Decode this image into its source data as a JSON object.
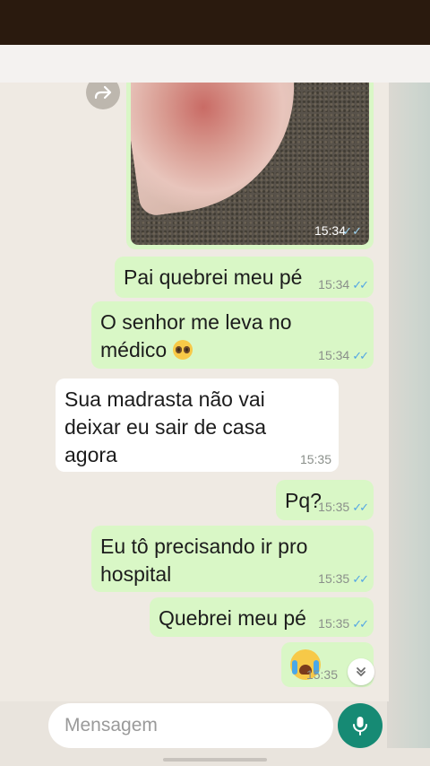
{
  "chat": {
    "image_message": {
      "time": "15:34",
      "status": "read"
    },
    "messages": [
      {
        "id": "m1",
        "direction": "out",
        "text": "Pai quebrei meu pé",
        "time": "15:34",
        "status": "read"
      },
      {
        "id": "m2",
        "direction": "out",
        "line1": "O senhor me leva no",
        "line2": "médico",
        "emoji": "pleading-face-emoji",
        "time": "15:34",
        "status": "read"
      },
      {
        "id": "m3",
        "direction": "in",
        "line1": "Sua madrasta não vai",
        "line2": "deixar eu sair de casa",
        "line3": "agora",
        "time": "15:35"
      },
      {
        "id": "m4",
        "direction": "out",
        "text": "Pq?",
        "time": "15:35",
        "status": "read"
      },
      {
        "id": "m5",
        "direction": "out",
        "line1": "Eu tô precisando ir pro",
        "line2": "hospital",
        "time": "15:35",
        "status": "read"
      },
      {
        "id": "m6",
        "direction": "out",
        "text": "Quebrei meu pé",
        "time": "15:35",
        "status": "read"
      },
      {
        "id": "m7",
        "direction": "out",
        "emoji": "loudly-crying-face-emoji",
        "time": "15:35"
      }
    ],
    "ticks": "✓✓"
  },
  "composer": {
    "placeholder": "Mensagem",
    "icons": [
      "smile-icon",
      "paperclip-icon",
      "camera-icon",
      "mic-icon"
    ]
  },
  "colors": {
    "outgoing_bubble": "#d9f7c6",
    "incoming_bubble": "#ffffff",
    "read_ticks": "#53a6e4",
    "mic_button": "#168a74",
    "chat_background": "#efeae3"
  }
}
